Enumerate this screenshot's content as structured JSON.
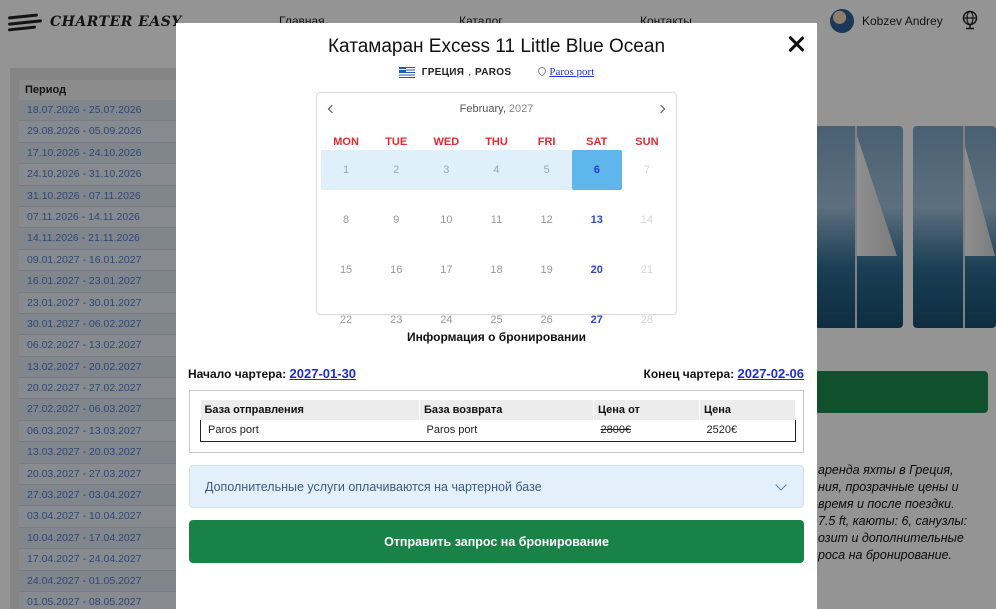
{
  "header": {
    "logo_text": "CHARTER EASY",
    "nav": [
      "Главная",
      "Каталог",
      "Контакты"
    ],
    "user_name": "Kobzev Andrey"
  },
  "periods": {
    "header": "Период",
    "rows": [
      "18.07.2026 - 25.07.2026",
      "29.08.2026 - 05.09.2026",
      "17.10.2026 - 24.10.2026",
      "24.10.2026 - 31.10.2026",
      "31.10.2026 - 07.11.2026",
      "07.11.2026 - 14.11.2026",
      "14.11.2026 - 21.11.2026",
      "09.01.2027 - 16.01.2027",
      "16.01.2027 - 23.01.2027",
      "23.01.2027 - 30.01.2027",
      "30.01.2027 - 06.02.2027",
      "06.02.2027 - 13.02.2027",
      "13.02.2027 - 20.02.2027",
      "20.02.2027 - 27.02.2027",
      "27.02.2027 - 06.03.2027",
      "06.03.2027 - 13.03.2027",
      "13.03.2027 - 20.03.2027",
      "20.03.2027 - 27.03.2027",
      "27.03.2027 - 03.04.2027",
      "03.04.2027 - 10.04.2027",
      "10.04.2027 - 17.04.2027",
      "17.04.2027 - 24.04.2027",
      "24.04.2027 - 01.05.2027",
      "01.05.2027 - 08.05.2027"
    ]
  },
  "background_text": [
    "аренда яхты в Греция,",
    "ния, прозрачные цены и",
    "время и после поездки.",
    "7.5 ft, каюты: 6, санузлы:",
    "озит и дополнительные",
    "роса на бронирование."
  ],
  "modal": {
    "title": "Катамаран Excess 11 Little Blue Ocean",
    "country": "ГРЕЦИЯ",
    "separator": ",",
    "region": "PAROS",
    "port": "Paros port",
    "calendar": {
      "month": "February,",
      "year": "2027",
      "weekdays": [
        "MON",
        "TUE",
        "WED",
        "THU",
        "FRI",
        "SAT",
        "SUN"
      ],
      "days": [
        {
          "n": "1",
          "state": "range"
        },
        {
          "n": "2",
          "state": "range"
        },
        {
          "n": "3",
          "state": "range"
        },
        {
          "n": "4",
          "state": "range"
        },
        {
          "n": "5",
          "state": "range"
        },
        {
          "n": "6",
          "state": "selected"
        },
        {
          "n": "7",
          "state": "sun"
        },
        {
          "n": "8",
          "state": "normal"
        },
        {
          "n": "9",
          "state": "normal"
        },
        {
          "n": "10",
          "state": "normal"
        },
        {
          "n": "11",
          "state": "normal"
        },
        {
          "n": "12",
          "state": "normal"
        },
        {
          "n": "13",
          "state": "sat"
        },
        {
          "n": "14",
          "state": "sun"
        },
        {
          "n": "15",
          "state": "normal"
        },
        {
          "n": "16",
          "state": "normal"
        },
        {
          "n": "17",
          "state": "normal"
        },
        {
          "n": "18",
          "state": "normal"
        },
        {
          "n": "19",
          "state": "normal"
        },
        {
          "n": "20",
          "state": "sat"
        },
        {
          "n": "21",
          "state": "sun"
        },
        {
          "n": "22",
          "state": "normal"
        },
        {
          "n": "23",
          "state": "normal"
        },
        {
          "n": "24",
          "state": "normal"
        },
        {
          "n": "25",
          "state": "normal"
        },
        {
          "n": "26",
          "state": "normal"
        },
        {
          "n": "27",
          "state": "sat"
        },
        {
          "n": "28",
          "state": "sun"
        }
      ]
    },
    "info_title": "Информация о бронировании",
    "start_label": "Начало чартера:",
    "start_date": "2027-01-30",
    "end_label": "Конец чартера:",
    "end_date": "2027-02-06",
    "table": {
      "headers": [
        "База отправления",
        "База возврата",
        "Цена от",
        "Цена"
      ],
      "row": {
        "from": "Paros port",
        "to": "Paros port",
        "price_from": "2800€",
        "price": "2520€"
      }
    },
    "extras_label": "Дополнительные услуги оплачиваются на чартерной базе",
    "submit_label": "Отправить запрос на бронирование"
  },
  "colors": {
    "accent_green": "#198347",
    "link_blue": "#1e2dd6",
    "weekday_red": "#e8282e",
    "selected_day": "#5fb6ec"
  }
}
